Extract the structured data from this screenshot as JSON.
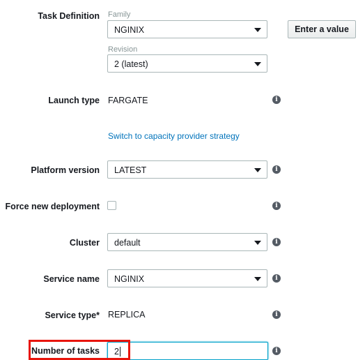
{
  "task_definition": {
    "label": "Task Definition",
    "family_label": "Family",
    "family_value": "NGINIX",
    "revision_label": "Revision",
    "revision_value": "2 (latest)",
    "enter_value_button": "Enter a value"
  },
  "launch_type": {
    "label": "Launch type",
    "value": "FARGATE"
  },
  "switch_link": "Switch to capacity provider strategy",
  "platform_version": {
    "label": "Platform version",
    "value": "LATEST"
  },
  "force_new_deployment": {
    "label": "Force new deployment",
    "checked": false
  },
  "cluster": {
    "label": "Cluster",
    "value": "default"
  },
  "service_name": {
    "label": "Service name",
    "value": "NGINIX"
  },
  "service_type": {
    "label": "Service type*",
    "value": "REPLICA"
  },
  "number_of_tasks": {
    "label": "Number of tasks",
    "value": "2"
  },
  "info_icon_glyph": "i",
  "colors": {
    "link": "#0073bb",
    "highlight": "#e8150c",
    "focus": "#00a1c9"
  }
}
